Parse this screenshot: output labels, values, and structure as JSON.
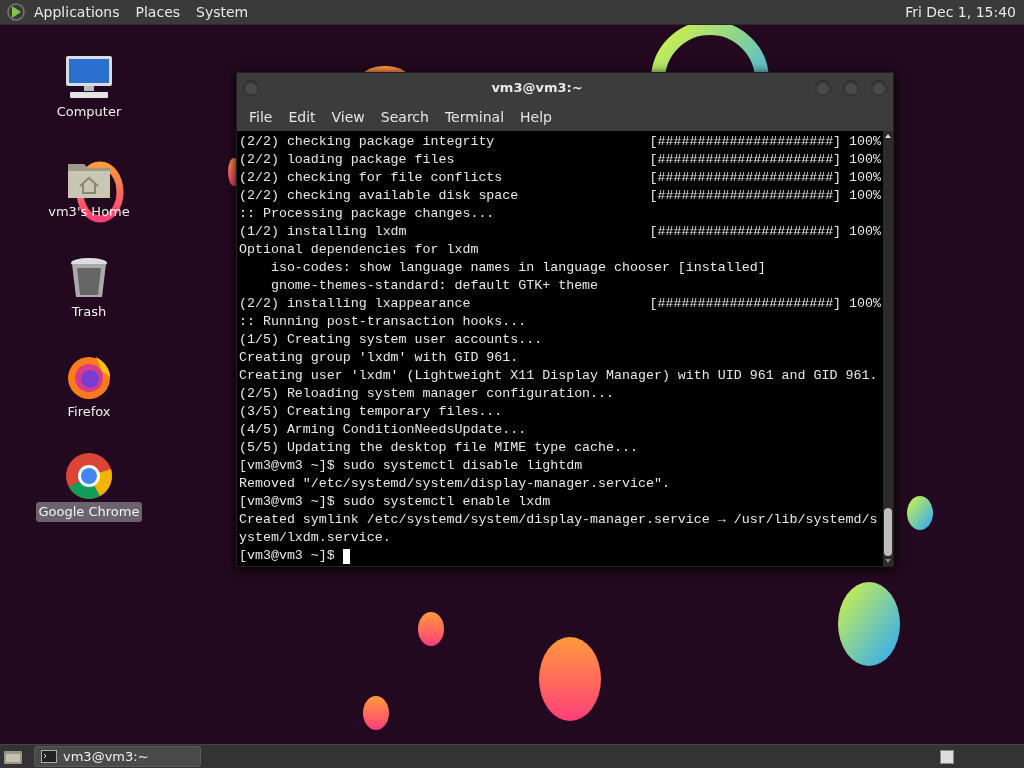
{
  "top_panel": {
    "menus": [
      "Applications",
      "Places",
      "System"
    ],
    "clock": "Fri Dec 1, 15:40"
  },
  "desktop_icons": [
    {
      "label": "Computer",
      "kind": "computer",
      "selected": false
    },
    {
      "label": "vm3's Home",
      "kind": "home",
      "selected": false
    },
    {
      "label": "Trash",
      "kind": "trash",
      "selected": false
    },
    {
      "label": "Firefox",
      "kind": "firefox",
      "selected": false
    },
    {
      "label": "Google Chrome",
      "kind": "chrome",
      "selected": true
    }
  ],
  "terminal": {
    "title": "vm3@vm3:~",
    "menu": [
      "File",
      "Edit",
      "View",
      "Search",
      "Terminal",
      "Help"
    ],
    "lines": [
      {
        "text": "(2/2) checking package integrity",
        "progress": "[######################] 100%"
      },
      {
        "text": "(2/2) loading package files",
        "progress": "[######################] 100%"
      },
      {
        "text": "(2/2) checking for file conflicts",
        "progress": "[######################] 100%"
      },
      {
        "text": "(2/2) checking available disk space",
        "progress": "[######################] 100%"
      },
      {
        "text": ":: Processing package changes..."
      },
      {
        "text": "(1/2) installing lxdm",
        "progress": "[######################] 100%"
      },
      {
        "text": "Optional dependencies for lxdm"
      },
      {
        "text": "    iso-codes: show language names in language chooser [installed]"
      },
      {
        "text": "    gnome-themes-standard: default GTK+ theme"
      },
      {
        "text": "(2/2) installing lxappearance",
        "progress": "[######################] 100%"
      },
      {
        "text": ":: Running post-transaction hooks..."
      },
      {
        "text": "(1/5) Creating system user accounts..."
      },
      {
        "text": "Creating group 'lxdm' with GID 961."
      },
      {
        "text": "Creating user 'lxdm' (Lightweight X11 Display Manager) with UID 961 and GID 961."
      },
      {
        "text": "(2/5) Reloading system manager configuration..."
      },
      {
        "text": "(3/5) Creating temporary files..."
      },
      {
        "text": "(4/5) Arming ConditionNeedsUpdate..."
      },
      {
        "text": "(5/5) Updating the desktop file MIME type cache..."
      },
      {
        "text": "[vm3@vm3 ~]$ sudo systemctl disable lightdm"
      },
      {
        "text": "Removed \"/etc/systemd/system/display-manager.service\"."
      },
      {
        "text": "[vm3@vm3 ~]$ sudo systemctl enable lxdm"
      },
      {
        "text": "Created symlink /etc/systemd/system/display-manager.service → /usr/lib/systemd/s"
      },
      {
        "text": "ystem/lxdm.service."
      }
    ],
    "prompt": "[vm3@vm3 ~]$ "
  },
  "taskbar": {
    "tasks": [
      "vm3@vm3:~"
    ]
  }
}
